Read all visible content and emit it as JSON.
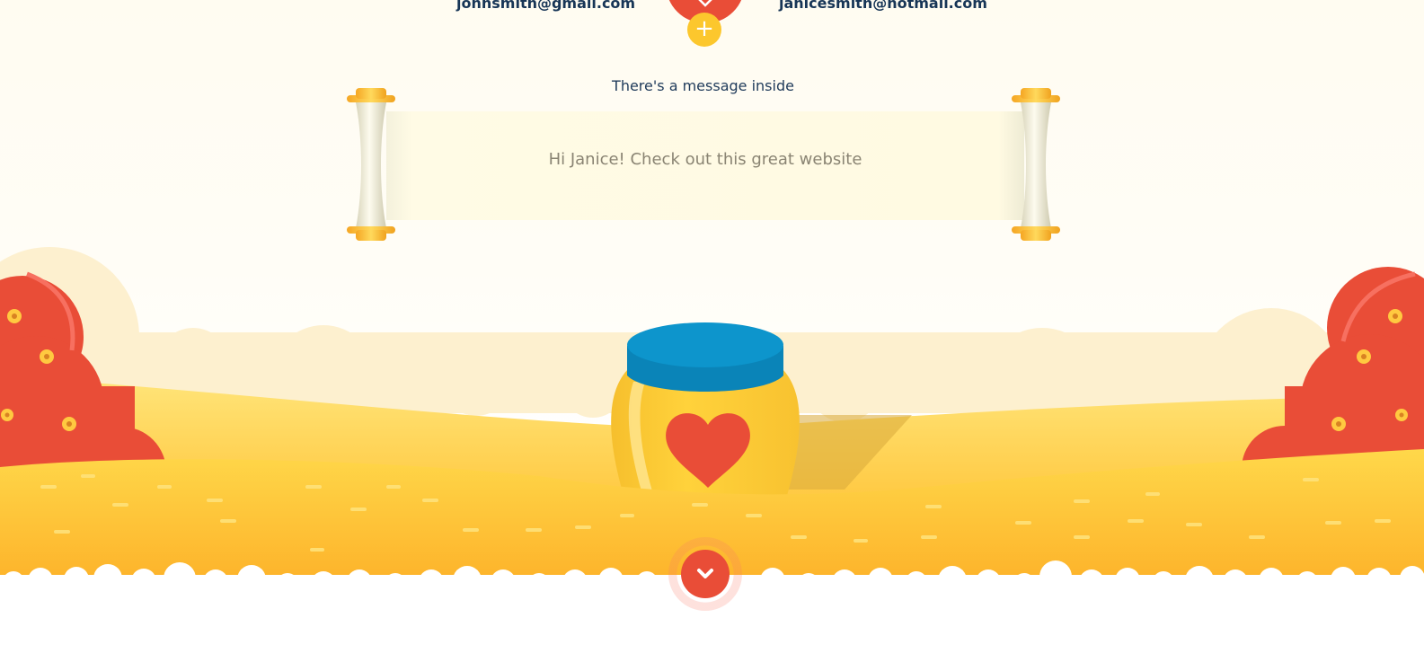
{
  "sender": {
    "email": "johnsmith@gmail.com"
  },
  "recipient": {
    "email": "janicesmith@hotmail.com"
  },
  "add_button": {
    "symbol": "+"
  },
  "message": {
    "label": "There's a message inside",
    "text": "Hi Janice! Check out this great website"
  },
  "scroll_down_button": {
    "icon": "chevron-down-icon"
  },
  "colors": {
    "heart_red": "#e94d37",
    "honey_yellow": "#fcc72d",
    "lid_blue": "#0d95cc",
    "navy_text": "#173556",
    "paper": "#fffae2"
  }
}
